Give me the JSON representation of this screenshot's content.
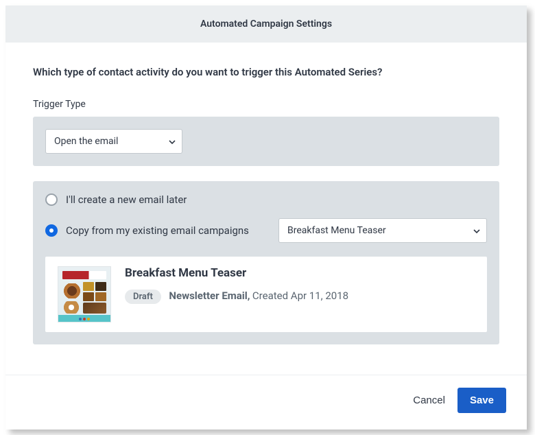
{
  "titlebar": {
    "title": "Automated Campaign Settings"
  },
  "question": "Which type of contact activity do you want to trigger this Automated Series?",
  "trigger": {
    "label": "Trigger Type",
    "selected": "Open the email"
  },
  "email_source": {
    "options": {
      "create_later": {
        "label": "I'll create a new email later",
        "checked": false
      },
      "copy_existing": {
        "label": "Copy from my existing email campaigns",
        "checked": true
      }
    },
    "campaign_select": {
      "selected": "Breakfast Menu Teaser"
    },
    "preview": {
      "title": "Breakfast Menu Teaser",
      "status": "Draft",
      "type_label": "Newsletter Email,",
      "created": "Created Apr 11, 2018"
    }
  },
  "footer": {
    "cancel": "Cancel",
    "save": "Save"
  }
}
